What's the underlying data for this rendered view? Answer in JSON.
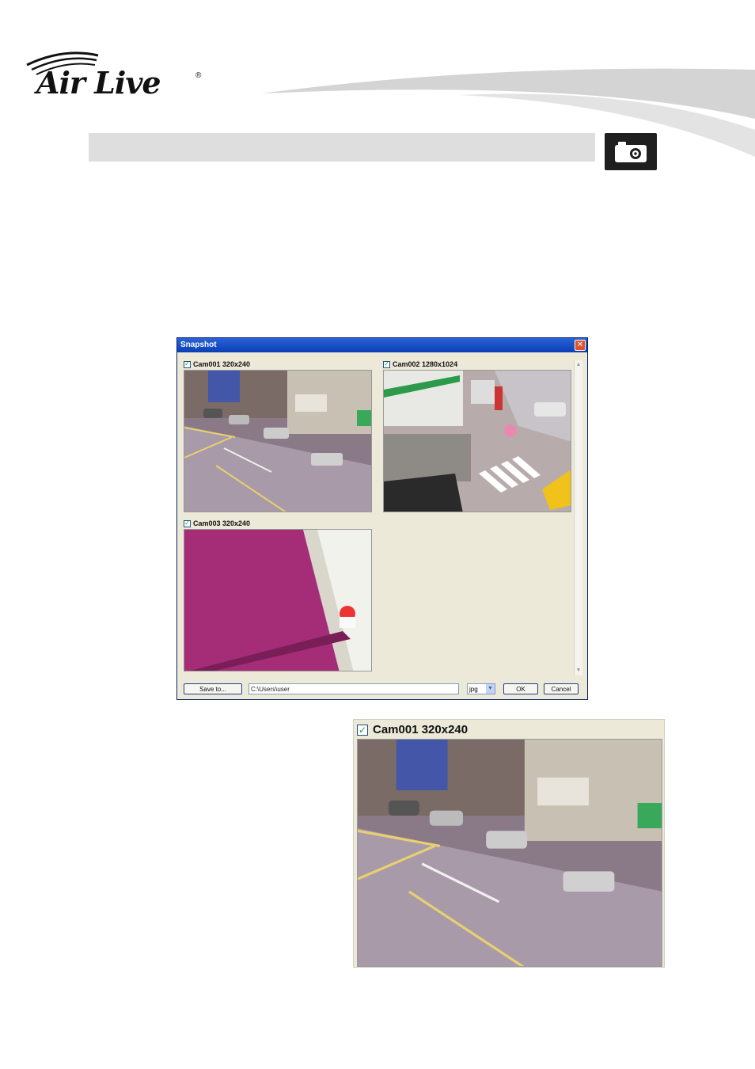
{
  "brand": {
    "logo_text": "Air Live",
    "registered": "®"
  },
  "icons": {
    "section": "camera-icon",
    "checkbox": "check-icon",
    "close": "close-icon",
    "dropdown": "chevron-down-icon"
  },
  "dialog": {
    "title": "Snapshot",
    "close_glyph": "✕",
    "cameras": [
      {
        "label": "Cam001 320x240",
        "checked": true
      },
      {
        "label": "Cam002 1280x1024",
        "checked": true
      },
      {
        "label": "Cam003 320x240",
        "checked": true
      }
    ],
    "save_to_label": "Save to...",
    "save_path": "C:\\Users\\user",
    "format_value": "jpg",
    "ok_label": "OK",
    "cancel_label": "Cancel"
  },
  "zoom": {
    "label": "Cam001 320x240",
    "checked": true
  },
  "colors": {
    "title_bar": "#0b3fb6",
    "dialog_bg": "#ece9d8",
    "section_bar": "#dedede"
  }
}
